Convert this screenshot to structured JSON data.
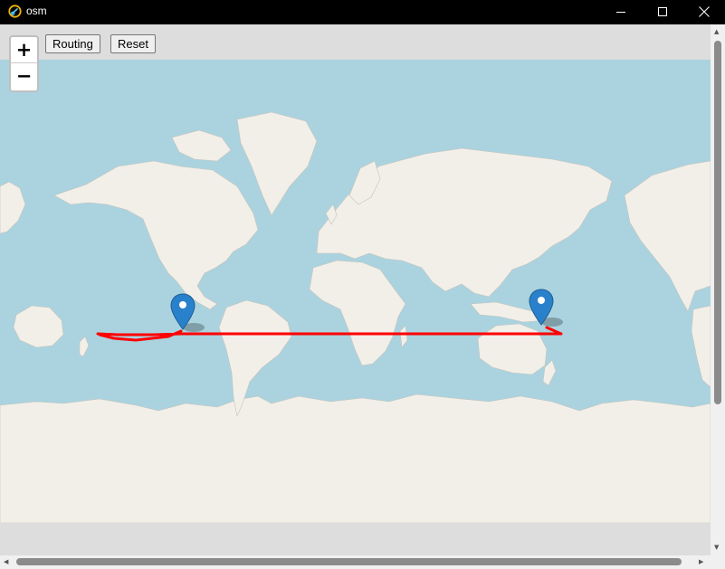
{
  "window": {
    "title": "osm",
    "icon": "link-icon",
    "controls": [
      "minimize-icon",
      "maximize-icon",
      "close-icon"
    ]
  },
  "map": {
    "zoom_in_label": "+",
    "zoom_out_label": "−",
    "colors": {
      "water": "#aad3df",
      "land": "#f2efe9",
      "ice": "#f2efe9",
      "route": "#ff0000",
      "marker": "#2a81cb"
    },
    "markers": [
      "map-marker-icon",
      "map-marker-icon"
    ]
  },
  "toolbar": {
    "routing_label": "Routing",
    "reset_label": "Reset"
  }
}
